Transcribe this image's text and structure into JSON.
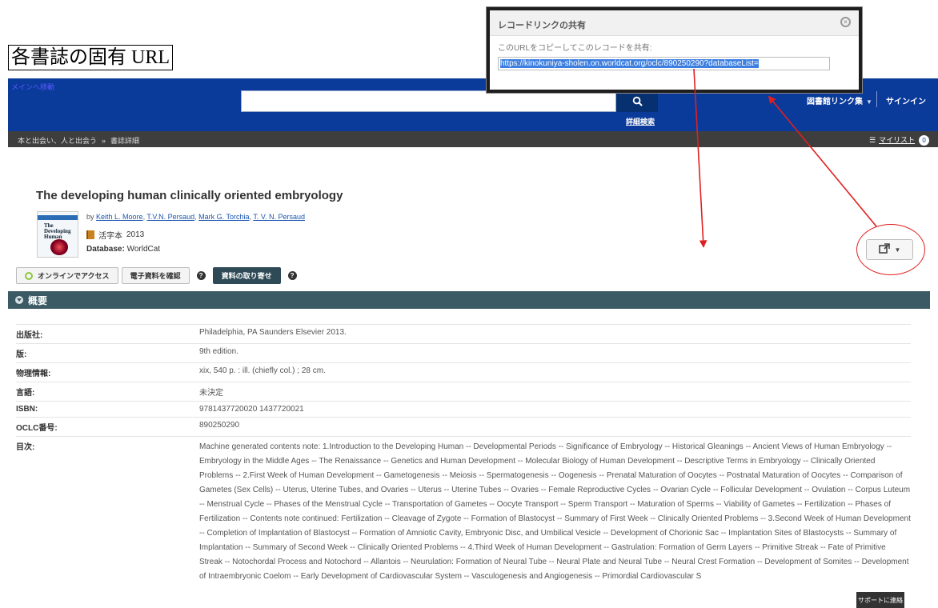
{
  "caption": "各書誌の固有 URL",
  "header": {
    "skip_link": "メインへ移動",
    "search_placeholder": "",
    "advanced_search": "詳細検索",
    "library_links": "図書館リンク集",
    "signin": "サインイン"
  },
  "breadcrumb": {
    "home": "本と出会い、人と出会う",
    "current": "書誌詳細"
  },
  "mylist": {
    "label": "マイリスト",
    "count": "0"
  },
  "record": {
    "title": "The developing human clinically oriented embryology",
    "by": "by",
    "authors": [
      "Keith L. Moore",
      "T.V.N. Persaud",
      "Mark G. Torchia",
      "T. V. N. Persaud"
    ],
    "format": "活字本",
    "year": "2013",
    "database_label": "Database:",
    "database_value": "WorldCat",
    "cover_text": "The Developing Human"
  },
  "actions": {
    "online_access": "オンラインでアクセス",
    "check_eresources": "電子資料を確認",
    "request_item": "資料の取り寄せ",
    "help": "?"
  },
  "section": {
    "title": "概要"
  },
  "details": [
    {
      "key": "出版社:",
      "value": "Philadelphia, PA Saunders Elsevier 2013."
    },
    {
      "key": "版:",
      "value": "9th edition."
    },
    {
      "key": "物理情報:",
      "value": "xix, 540 p. : ill. (chiefly col.) ; 28 cm."
    },
    {
      "key": "言語:",
      "value": "未決定"
    },
    {
      "key": "ISBN:",
      "value": "9781437720020 1437720021"
    },
    {
      "key": "OCLC番号:",
      "value": "890250290"
    },
    {
      "key": "目次:",
      "value": "Machine generated contents note: 1.Introduction to the Developing Human -- Developmental Periods -- Significance of Embryology -- Historical Gleanings -- Ancient Views of Human Embryology -- Embryology in the Middle Ages -- The Renaissance -- Genetics and Human Development -- Molecular Biology of Human Development -- Descriptive Terms in Embryology -- Clinically Oriented Problems -- 2.First Week of Human Development -- Gametogenesis -- Meiosis -- Spermatogenesis -- Oogenesis -- Prenatal Maturation of Oocytes -- Postnatal Maturation of Oocytes -- Comparison of Gametes (Sex Cells) -- Uterus, Uterine Tubes, and Ovaries -- Uterus -- Uterine Tubes -- Ovaries -- Female Reproductive Cycles -- Ovarian Cycle -- Follicular Development -- Ovulation -- Corpus Luteum -- Menstrual Cycle -- Phases of the Menstrual Cycle -- Transportation of Gametes -- Oocyte Transport -- Sperm Transport -- Maturation of Sperms -- Viability of Gametes -- Fertilization -- Phases of Fertilization -- Contents note continued: Fertilization -- Cleavage of Zygote -- Formation of Blastocyst -- Summary of First Week -- Clinically Oriented Problems -- 3.Second Week of Human Development -- Completion of Implantation of Blastocyst -- Formation of Amniotic Cavity, Embryonic Disc, and Umbilical Vesicle -- Development of Chorionic Sac -- Implantation Sites of Blastocysts -- Summary of Implantation -- Summary of Second Week -- Clinically Oriented Problems -- 4.Third Week of Human Development -- Gastrulation: Formation of Germ Layers -- Primitive Streak -- Fate of Primitive Streak -- Notochordal Process and Notochord -- Allantois -- Neurulation: Formation of Neural Tube -- Neural Plate and Neural Tube -- Neural Crest Formation -- Development of Somites -- Development of Intraembryonic Coelom -- Early Development of Cardiovascular System -- Vasculogenesis and Angiogenesis -- Primordial Cardiovascular S"
    }
  ],
  "support": "サポートに連絡",
  "share_dialog": {
    "title": "レコードリンクの共有",
    "instruction": "このURLをコピーしてこのレコードを共有:",
    "url": "https://kinokuniya-sholen.on.worldcat.org/oclc/890250290?databaseList="
  },
  "colors": {
    "header_blue": "#0a3a9a",
    "section_teal": "#3b5a63",
    "annotation_red": "#e02020"
  }
}
